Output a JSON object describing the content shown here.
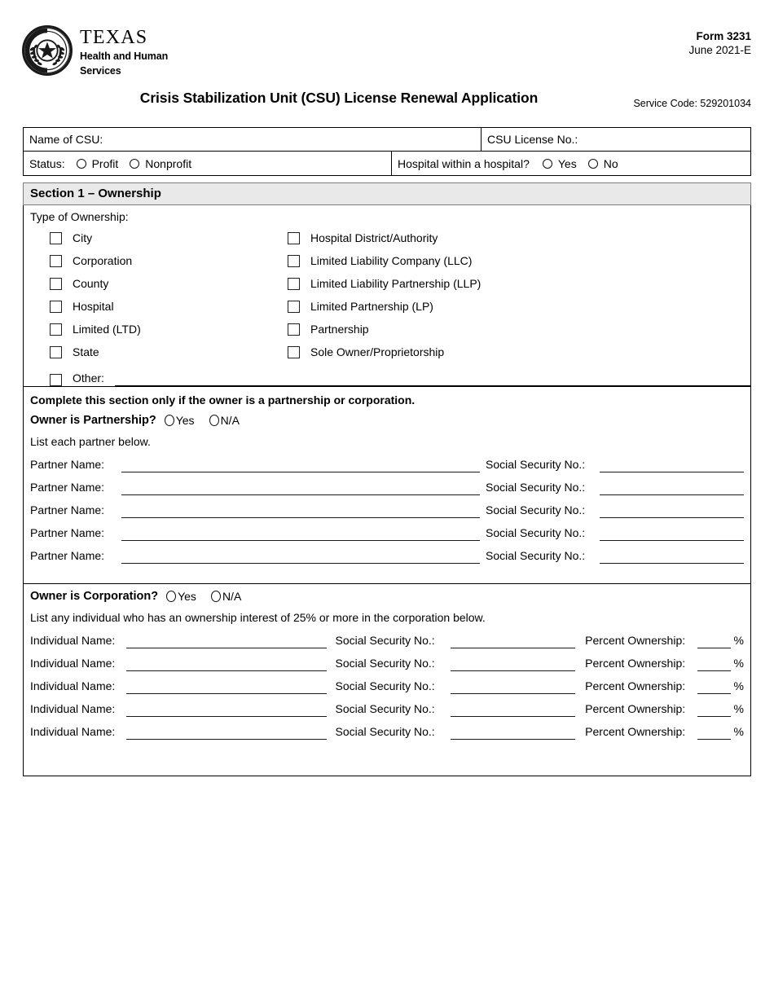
{
  "header": {
    "logo": {
      "seal_alt": "texas-state-seal",
      "line1": "TEXAS",
      "line2": "Health and Human",
      "line3": "Services"
    },
    "form_number": "Form 3231",
    "form_date": "June 2021-E",
    "title": "Crisis Stabilization Unit (CSU) License Renewal Application",
    "service_code": "Service Code: 529201034"
  },
  "top_table": {
    "name_label": "Name of CSU:",
    "license_label": "CSU License No.:",
    "status_label": "Status:",
    "status_options": [
      "Profit",
      "Nonprofit"
    ],
    "hospital_label": "Hospital within a hospital?",
    "hospital_options": [
      "Yes",
      "No"
    ]
  },
  "section1": {
    "heading": "Section 1 – Ownership",
    "ownership_label": "Type of Ownership:",
    "ownership_left": [
      "City",
      "Corporation",
      "County",
      "Hospital",
      "Limited (LTD)",
      "State"
    ],
    "ownership_right": [
      "Hospital District/Authority",
      "Limited Liability Company (LLC)",
      "Limited Liability Partnership (LLP)",
      "Limited Partnership (LP)",
      "Partnership",
      "Sole Owner/Proprietorship"
    ],
    "other_label": "Other:",
    "complete_note": "Complete this section only if the owner is a partnership or corporation.",
    "partnership_question": "Owner is Partnership?",
    "partnership_options": [
      "Yes",
      "N/A"
    ],
    "partner_instruction": "List each partner below.",
    "partner_name_label": "Partner Name:",
    "partner_ssn_label": "Social Security No.:",
    "partner_rows": [
      1,
      2,
      3,
      4,
      5
    ],
    "corporation_question": "Owner is Corporation?",
    "corporation_options": [
      "Yes",
      "N/A"
    ],
    "corporation_instruction": "List any individual who has an ownership interest of 25% or more in the corporation below.",
    "individual_name_label": "Individual Name:",
    "individual_ssn_label": "Social Security No.:",
    "percent_label": "Percent Ownership:",
    "percent_sign": "%",
    "individual_rows": [
      1,
      2,
      3,
      4,
      5
    ]
  },
  "colors": {
    "section_header_bg": "#e9e9e9",
    "border": "#000000",
    "text": "#000000"
  }
}
